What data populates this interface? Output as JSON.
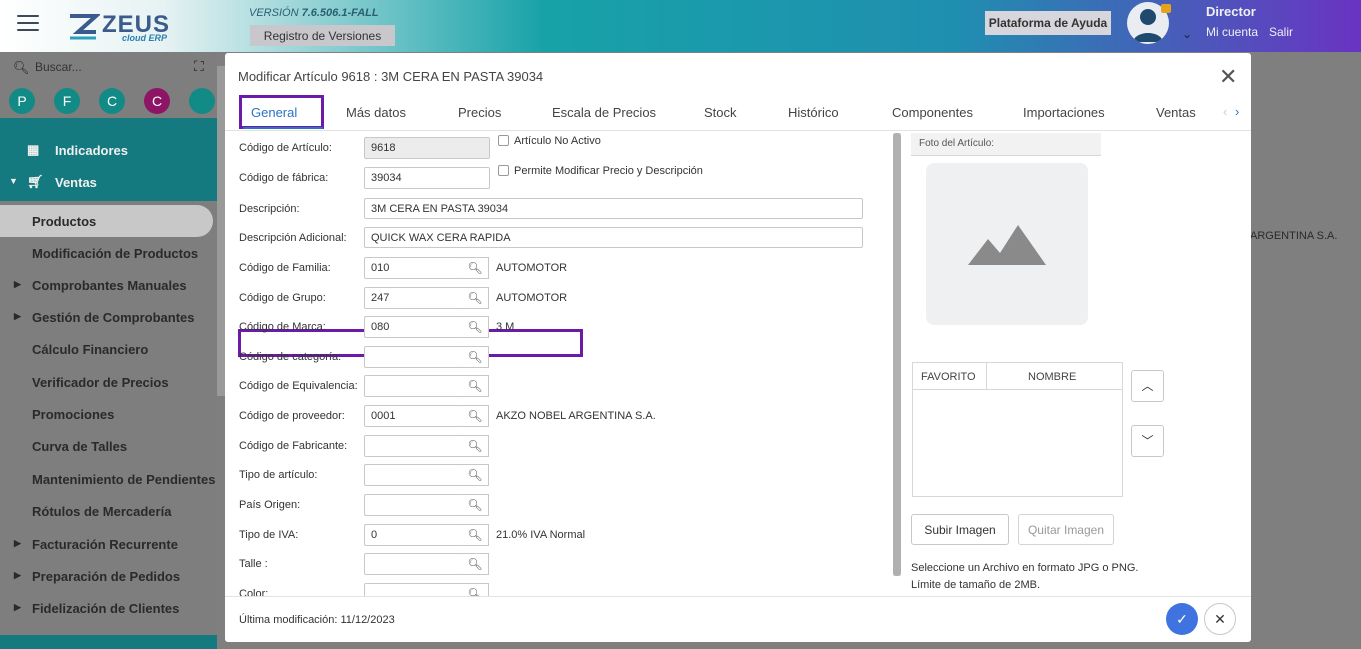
{
  "header": {
    "version_label": "VERSIÓN",
    "version_value": "7.6.506.1-FALL",
    "registro_button": "Registro de Versiones",
    "help_button": "Plataforma de Ayuda",
    "user_name": "Director",
    "my_account": "Mi cuenta",
    "logout": "Salir",
    "logo_text": "ZEUS",
    "logo_sub": "cloud ERP"
  },
  "sidebar": {
    "search_placeholder": "Buscar...",
    "circles": [
      "P",
      "F",
      "C",
      "C",
      ""
    ],
    "top_items": [
      {
        "label": "Indicadores",
        "icon": "dashboard-icon"
      },
      {
        "label": "Ventas",
        "icon": "cart-icon"
      }
    ],
    "sub_items": [
      {
        "label": "Productos",
        "arrow": false,
        "active": true
      },
      {
        "label": "Modificación de Productos",
        "arrow": false
      },
      {
        "label": "Comprobantes Manuales",
        "arrow": true
      },
      {
        "label": "Gestión de Comprobantes",
        "arrow": true
      },
      {
        "label": "Cálculo Financiero",
        "arrow": false
      },
      {
        "label": "Verificador de Precios",
        "arrow": false
      },
      {
        "label": "Promociones",
        "arrow": false
      },
      {
        "label": "Curva de Talles",
        "arrow": false
      },
      {
        "label": "Mantenimiento de Pendientes",
        "arrow": false
      },
      {
        "label": "Rótulos de Mercadería",
        "arrow": false
      },
      {
        "label": "Facturación Recurrente",
        "arrow": true
      },
      {
        "label": "Preparación de Pedidos",
        "arrow": true
      },
      {
        "label": "Fidelización de Clientes",
        "arrow": true
      }
    ]
  },
  "background": {
    "right_text": "ARGENTINA S.A."
  },
  "modal": {
    "title": "Modificar Artículo 9618 : 3M CERA EN PASTA 39034",
    "tabs": [
      "General",
      "Más datos",
      "Precios",
      "Escala de Precios",
      "Stock",
      "Histórico",
      "Componentes",
      "Importaciones",
      "Ventas"
    ],
    "fields": {
      "codigo_articulo": {
        "label": "Código de Artículo:",
        "value": "9618"
      },
      "codigo_fabrica": {
        "label": "Código de fábrica:",
        "value": "39034"
      },
      "descripcion": {
        "label": "Descripción:",
        "value": "3M CERA EN PASTA 39034"
      },
      "descripcion_adicional": {
        "label": "Descripción Adicional:",
        "value": "QUICK WAX CERA RAPIDA"
      },
      "familia": {
        "label": "Código de Familia:",
        "value": "010",
        "desc": "AUTOMOTOR"
      },
      "grupo": {
        "label": "Código de Grupo:",
        "value": "247",
        "desc": "AUTOMOTOR"
      },
      "marca": {
        "label": "Código de Marca:",
        "value": "080",
        "desc": "3 M"
      },
      "categoria": {
        "label": "Código de categoría:",
        "value": "",
        "desc": ""
      },
      "equivalencia": {
        "label": "Código de Equivalencia:",
        "value": "",
        "desc": ""
      },
      "proveedor": {
        "label": "Código de proveedor:",
        "value": "0001",
        "desc": "AKZO NOBEL ARGENTINA S.A."
      },
      "fabricante": {
        "label": "Código de Fabricante:",
        "value": "",
        "desc": ""
      },
      "tipo_articulo": {
        "label": "Tipo de artículo:",
        "value": "",
        "desc": ""
      },
      "pais_origen": {
        "label": "País Origen:",
        "value": "",
        "desc": ""
      },
      "tipo_iva": {
        "label": "Tipo de IVA:",
        "value": "0",
        "desc": "21.0% IVA Normal"
      },
      "talle": {
        "label": "Talle :",
        "value": "",
        "desc": ""
      },
      "color": {
        "label": "Color:",
        "value": "",
        "desc": ""
      }
    },
    "checkboxes": {
      "no_activo": "Artículo No Activo",
      "permite_modificar": "Permite Modificar Precio y Descripción"
    },
    "image_panel": {
      "photo_header": "Foto del Artículo:",
      "col_favorito": "FAVORITO",
      "col_nombre": "NOMBRE",
      "upload_button": "Subir Imagen",
      "remove_button": "Quitar Imagen",
      "hint_line1": "Seleccione un Archivo en formato JPG o PNG.",
      "hint_line2": "Límite de tamaño de 2MB."
    },
    "footer": {
      "last_modified": "Última modificación: 11/12/2023"
    }
  }
}
